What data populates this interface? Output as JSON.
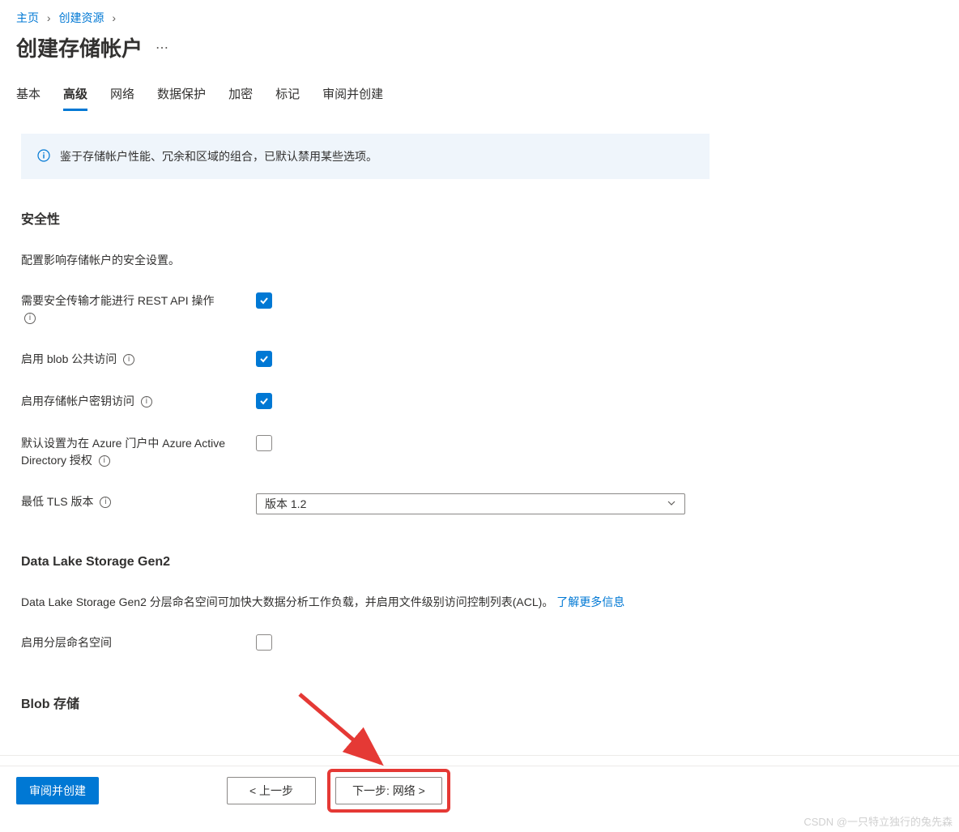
{
  "breadcrumb": {
    "home": "主页",
    "create_resource": "创建资源"
  },
  "page_title": "创建存储帐户",
  "tabs": [
    {
      "label": "基本"
    },
    {
      "label": "高级"
    },
    {
      "label": "网络"
    },
    {
      "label": "数据保护"
    },
    {
      "label": "加密"
    },
    {
      "label": "标记"
    },
    {
      "label": "审阅并创建"
    }
  ],
  "info_banner": "鉴于存储帐户性能、冗余和区域的组合，已默认禁用某些选项。",
  "security": {
    "title": "安全性",
    "desc": "配置影响存储帐户的安全设置。",
    "fields": {
      "secure_transfer_label": "需要安全传输才能进行 REST API 操作",
      "blob_public_label": "启用 blob 公共访问",
      "account_key_label": "启用存储帐户密钥访问",
      "aad_default_label": "默认设置为在 Azure 门户中 Azure Active Directory 授权",
      "tls_label": "最低 TLS 版本",
      "tls_value": "版本 1.2"
    }
  },
  "datalake": {
    "title": "Data Lake Storage Gen2",
    "desc": "Data Lake Storage Gen2 分层命名空间可加快大数据分析工作负载，并启用文件级别访问控制列表(ACL)。",
    "learn_more": "了解更多信息",
    "hns_label": "启用分层命名空间"
  },
  "blob_storage": {
    "title": "Blob 存储"
  },
  "footer": {
    "review_create": "审阅并创建",
    "previous": "< 上一步",
    "next": "下一步: 网络 >"
  },
  "watermark": "CSDN @一只特立独行的兔先森"
}
